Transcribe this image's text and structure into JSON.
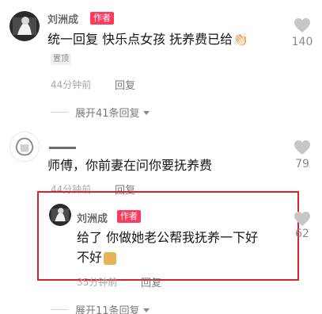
{
  "comments": [
    {
      "username": "刘洲成",
      "author_tag": "作者",
      "text": "统一回复 快乐点女孩 抚养费已给👏🏻",
      "pinned": "置顶",
      "time": "44分钟前",
      "reply": "回复",
      "likes": "140",
      "expand": "展开41条回复"
    },
    {
      "username": "",
      "text": "师傅，你前妻在问你要抚养费",
      "time": "44分钟前",
      "reply": "回复",
      "likes": "79"
    }
  ],
  "reply": {
    "username": "刘洲成",
    "author_tag": "作者",
    "text_line1": "给了 你做她老公帮我抚养一下好",
    "text_line2": "不好",
    "time": "35分钟前",
    "reply": "回复",
    "likes": "62"
  },
  "expand2": "展开11条回复",
  "colors": {
    "author_tag": "#ff3b5c",
    "highlight_border": "#d8232a"
  }
}
